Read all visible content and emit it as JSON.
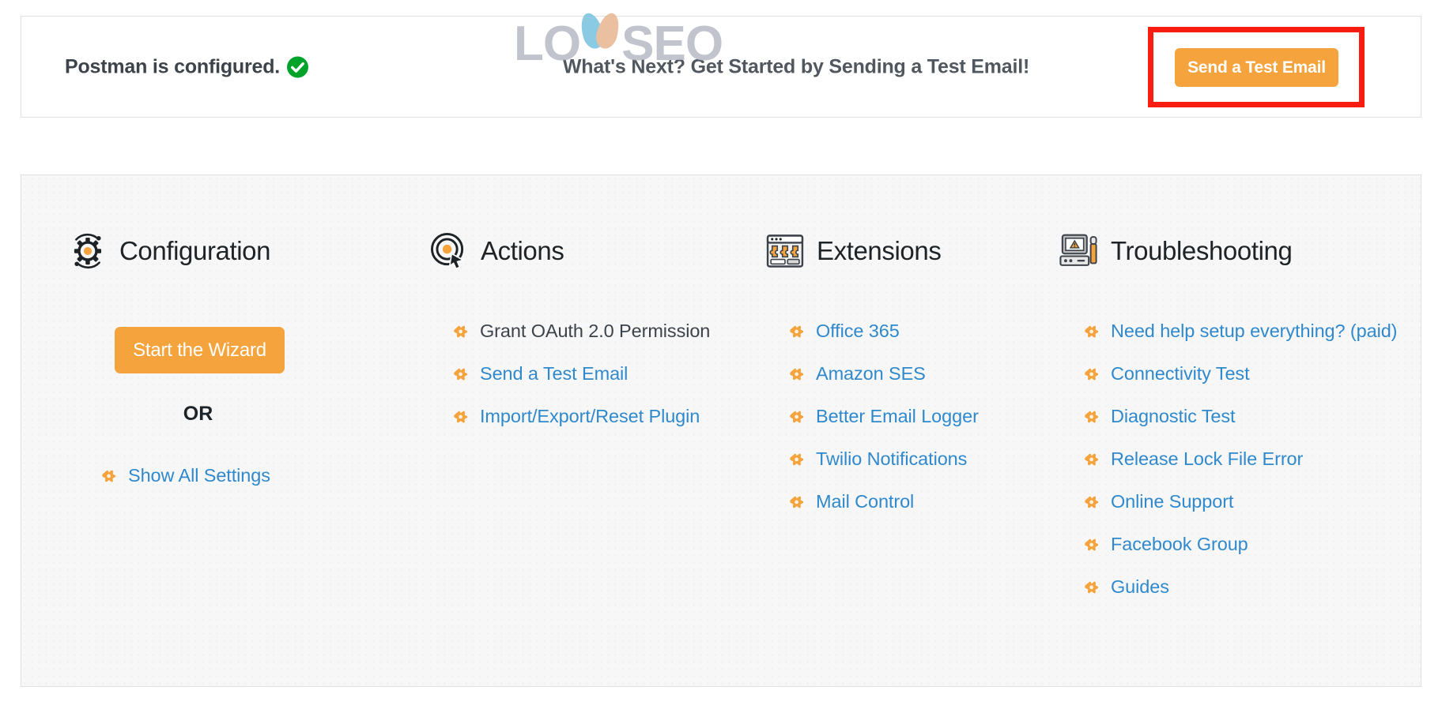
{
  "status_bar": {
    "configured_text": "Postman is configured.",
    "check_icon": "check-circle-icon",
    "next_step_text": "What's Next? Get Started by Sending a Test Email!",
    "send_test_email_button": "Send a Test Email",
    "annotation": "red-highlight-box"
  },
  "watermark": {
    "text_before": "LO",
    "text_after": "SEO",
    "leaf_blue": "#7cc3e0",
    "leaf_peach": "#e9b894",
    "letter_color": "#b9bcc7"
  },
  "colors": {
    "accent_orange": "#f5a33c",
    "link_blue": "#2f89cc",
    "success_green": "#00a32a",
    "annotation_red": "#f91c10",
    "panel_bg": "#f7f7f7",
    "text_dark": "#3c434a"
  },
  "columns": [
    {
      "title": "Configuration",
      "icon": "gear-settings-icon",
      "wizard_button": "Start the Wizard",
      "or_label": "OR",
      "show_all_settings": "Show All Settings"
    },
    {
      "title": "Actions",
      "icon": "target-cursor-icon",
      "links": [
        {
          "label": "Grant OAuth 2.0 Permission",
          "is_link": false
        },
        {
          "label": "Send a Test Email",
          "is_link": true
        },
        {
          "label": "Import/Export/Reset Plugin",
          "is_link": true
        }
      ]
    },
    {
      "title": "Extensions",
      "icon": "browser-extensions-icon",
      "links": [
        {
          "label": "Office 365",
          "is_link": true
        },
        {
          "label": "Amazon SES",
          "is_link": true
        },
        {
          "label": "Better Email Logger",
          "is_link": true
        },
        {
          "label": "Twilio Notifications",
          "is_link": true
        },
        {
          "label": "Mail Control",
          "is_link": true
        }
      ]
    },
    {
      "title": "Troubleshooting",
      "icon": "monitor-warning-screwdriver-icon",
      "links": [
        {
          "label": "Need help setup everything? (paid)",
          "is_link": true
        },
        {
          "label": "Connectivity Test",
          "is_link": true
        },
        {
          "label": "Diagnostic Test",
          "is_link": true
        },
        {
          "label": "Release Lock File Error",
          "is_link": true
        },
        {
          "label": "Online Support",
          "is_link": true
        },
        {
          "label": "Facebook Group",
          "is_link": true
        },
        {
          "label": "Guides",
          "is_link": true
        }
      ]
    }
  ]
}
